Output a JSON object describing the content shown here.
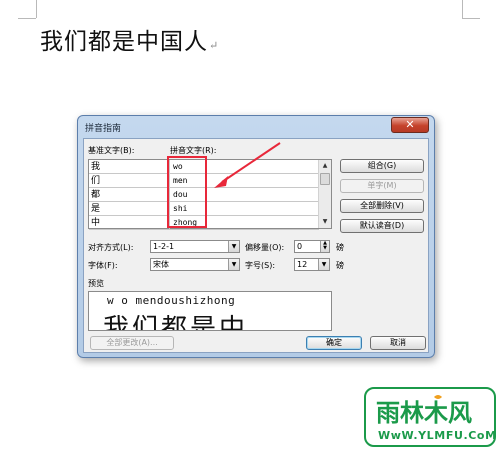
{
  "document": {
    "text": "我们都是中国人",
    "paragraph_mark": "↵"
  },
  "dialog": {
    "title": "拼音指南",
    "close_glyph": "✕",
    "base_text_label": "基准文字(B):",
    "pinyin_text_label": "拼音文字(R):",
    "rows": [
      {
        "base": "我",
        "pinyin": "wo"
      },
      {
        "base": "们",
        "pinyin": "men"
      },
      {
        "base": "都",
        "pinyin": "dou"
      },
      {
        "base": "是",
        "pinyin": "shi"
      },
      {
        "base": "中",
        "pinyin": "zhong"
      }
    ],
    "buttons": {
      "combine": "组合(G)",
      "single": "单字(M)",
      "clear_all": "全部删除(V)",
      "default_reading": "默认读音(D)",
      "change_all": "全部更改(A)...",
      "ok": "确定",
      "cancel": "取消"
    },
    "align_label": "对齐方式(L):",
    "align_value": "1-2-1",
    "offset_label": "偏移量(O):",
    "offset_value": "0",
    "offset_unit": "磅",
    "font_label": "字体(F):",
    "font_value": "宋体",
    "size_label": "字号(S):",
    "size_value": "12",
    "size_unit": "磅",
    "preview_label": "预览",
    "preview_pinyin": "w o mendoushizhong",
    "preview_hanzi": "我们都是中"
  },
  "watermark": {
    "name": "雨林木风",
    "url": "WwW.YLMFU.CoM"
  },
  "colors": {
    "highlight_red": "#e8283a",
    "watermark_green": "#1b9a4a",
    "titlebar_blue": "#b3cbe6"
  }
}
